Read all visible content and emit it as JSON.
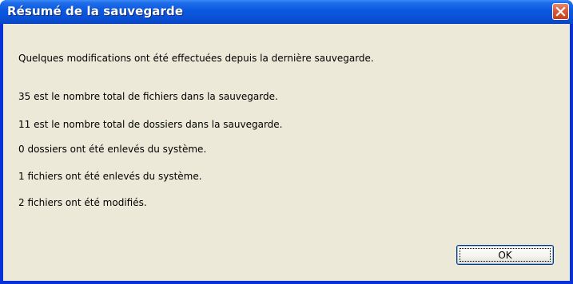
{
  "window": {
    "title": "Résumé de la sauvegarde"
  },
  "message": {
    "intro": "Quelques modifications ont été effectuées depuis la dernière sauvegarde.",
    "lines": [
      "35 est le nombre total de fichiers dans la sauvegarde.",
      "11 est le nombre total de dossiers dans la sauvegarde.",
      "0 dossiers ont été enlevés du système.",
      "1 fichiers ont été enlevés du système.",
      "2 fichiers ont été modifiés."
    ]
  },
  "buttons": {
    "ok_label": "OK"
  },
  "icons": {
    "close": "close-icon"
  },
  "colors": {
    "titlebar": "#0a58e0",
    "client": "#ece9d8",
    "close_button": "#d85a36"
  }
}
